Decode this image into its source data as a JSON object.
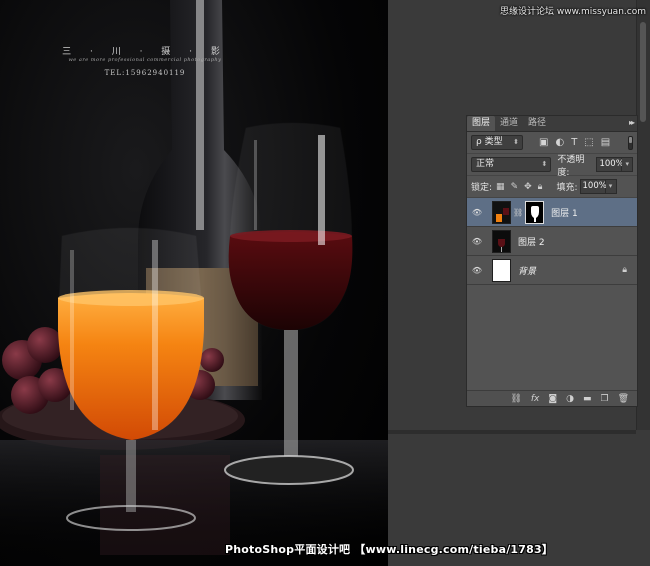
{
  "canvas": {
    "studio_name": "三 · 川 · 摄 · 影",
    "studio_tagline": "we are more professional commercial photography",
    "studio_tel": "TEL:15962940119"
  },
  "layers_panel": {
    "tabs": [
      {
        "label": "图层",
        "active": true
      },
      {
        "label": "通道",
        "active": false
      },
      {
        "label": "路径",
        "active": false
      }
    ],
    "menu_glyph": "▸▸",
    "filter_label": "ρ 类型",
    "filter_icons": [
      "image-filter-icon",
      "adjustment-filter-icon",
      "text-filter-icon",
      "shape-filter-icon",
      "smart-object-filter-icon"
    ],
    "blend_mode": "正常",
    "opacity_label": "不透明度:",
    "opacity_value": "100%",
    "lock_label": "锁定:",
    "lock_icons": [
      "lock-transparent-icon",
      "lock-pixels-icon",
      "lock-position-icon",
      "lock-all-icon"
    ],
    "fill_label": "填充:",
    "fill_value": "100%",
    "layers": [
      {
        "name": "图层 1",
        "selected": true,
        "has_mask": true
      },
      {
        "name": "图层 2",
        "selected": false,
        "has_mask": false
      },
      {
        "name": "背景",
        "selected": false,
        "has_mask": false,
        "locked": true
      }
    ],
    "footer_icons": [
      "link-layers-icon",
      "fx-icon",
      "add-mask-icon",
      "adjustment-layer-icon",
      "new-group-icon",
      "new-layer-icon",
      "trash-icon"
    ]
  },
  "watermarks": {
    "top": "思缘设计论坛 www.missyuan.com",
    "bottom": "PhotoShop平面设计吧 【www.linecg.com/tieba/1783】"
  },
  "colors": {
    "workspace_bg": "#3a3a3a",
    "panel_bg": "#535353",
    "selected_layer": "#5e6f86",
    "juice": "#f07a10",
    "wine": "#3a0608"
  }
}
